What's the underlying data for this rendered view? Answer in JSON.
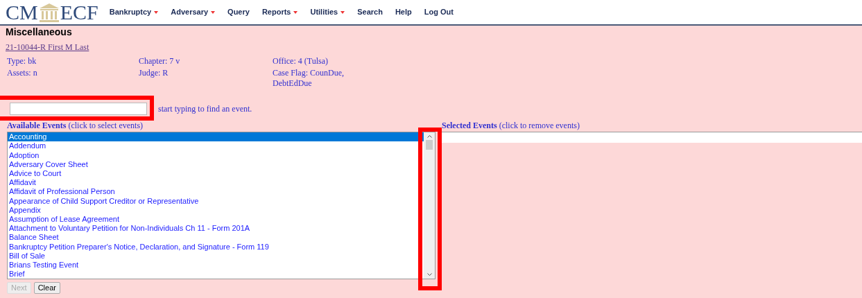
{
  "logo": {
    "left": "CM",
    "right": "ECF"
  },
  "menu": [
    {
      "label": "Bankruptcy",
      "dropdown": true
    },
    {
      "label": "Adversary",
      "dropdown": true
    },
    {
      "label": "Query",
      "dropdown": false
    },
    {
      "label": "Reports",
      "dropdown": true
    },
    {
      "label": "Utilities",
      "dropdown": true
    },
    {
      "label": "Search",
      "dropdown": false
    },
    {
      "label": "Help",
      "dropdown": false
    },
    {
      "label": "Log Out",
      "dropdown": false
    }
  ],
  "page_title": "Miscellaneous",
  "case_link": "21-10044-R First M Last",
  "case_info": [
    [
      "Type: bk",
      "Chapter: 7 v",
      "Office: 4 (Tulsa)"
    ],
    [
      "Assets: n",
      "Judge: R",
      "Case Flag: CounDue, DebtEdDue"
    ]
  ],
  "search": {
    "hint": "start typing to find an event.",
    "highlighted": true
  },
  "available": {
    "heading": "Available Events",
    "note": "(click to select events)",
    "scrollbar_highlighted": true,
    "items": [
      {
        "label": "Accounting",
        "selected": true
      },
      {
        "label": "Addendum",
        "selected": false
      },
      {
        "label": "Adoption",
        "selected": false
      },
      {
        "label": "Adversary Cover Sheet",
        "selected": false
      },
      {
        "label": "Advice to Court",
        "selected": false
      },
      {
        "label": "Affidavit",
        "selected": false
      },
      {
        "label": "Affidavit of Professional Person",
        "selected": false
      },
      {
        "label": "Appearance of Child Support Creditor or Representative",
        "selected": false
      },
      {
        "label": "Appendix",
        "selected": false
      },
      {
        "label": "Assumption of Lease Agreement",
        "selected": false
      },
      {
        "label": "Attachment to Voluntary Petition for Non-Individuals Ch 11 - Form 201A",
        "selected": false
      },
      {
        "label": "Balance Sheet",
        "selected": false
      },
      {
        "label": "Bankruptcy Petition Preparer's Notice, Declaration, and Signature - Form 119",
        "selected": false
      },
      {
        "label": "Bill of Sale",
        "selected": false
      },
      {
        "label": "Brians Testing Event",
        "selected": false
      },
      {
        "label": "Brief",
        "selected": false
      }
    ]
  },
  "selected_events": {
    "heading": "Selected Events",
    "note": "(click to remove events)"
  },
  "buttons": [
    {
      "label": "Next",
      "disabled": true
    },
    {
      "label": "Clear",
      "disabled": false
    }
  ]
}
